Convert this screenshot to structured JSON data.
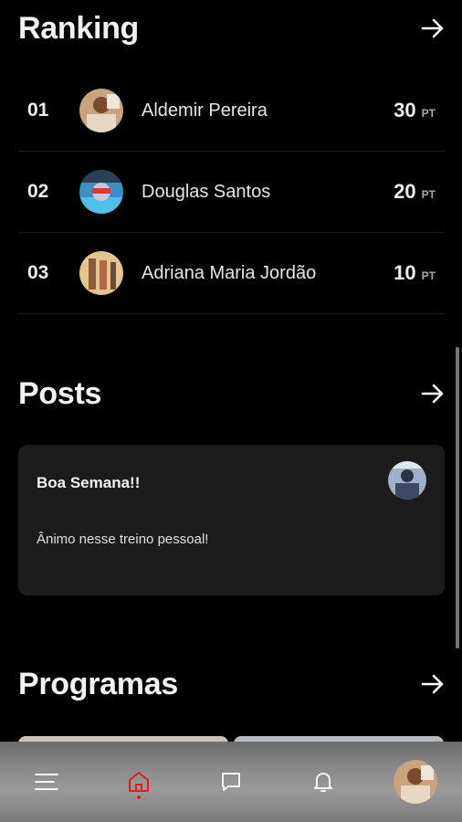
{
  "ranking": {
    "title": "Ranking",
    "arrow_icon": "arrow-right-icon",
    "rows": [
      {
        "position": "01",
        "name": "Aldemir Pereira",
        "points": "30",
        "unit": "PT"
      },
      {
        "position": "02",
        "name": "Douglas Santos",
        "points": "20",
        "unit": "PT"
      },
      {
        "position": "03",
        "name": "Adriana Maria Jordão",
        "points": "10",
        "unit": "PT"
      }
    ]
  },
  "posts": {
    "title": "Posts",
    "arrow_icon": "arrow-right-icon",
    "card": {
      "title": "Boa Semana!!",
      "body": "Ânimo nesse treino pessoal!"
    }
  },
  "programs": {
    "title": "Programas",
    "arrow_icon": "arrow-right-icon"
  },
  "bottom_nav": {
    "items": [
      "menu-icon",
      "home-icon",
      "chat-icon",
      "bell-icon",
      "profile-avatar"
    ],
    "active": "home-icon",
    "accent_color": "#e01e1e"
  }
}
